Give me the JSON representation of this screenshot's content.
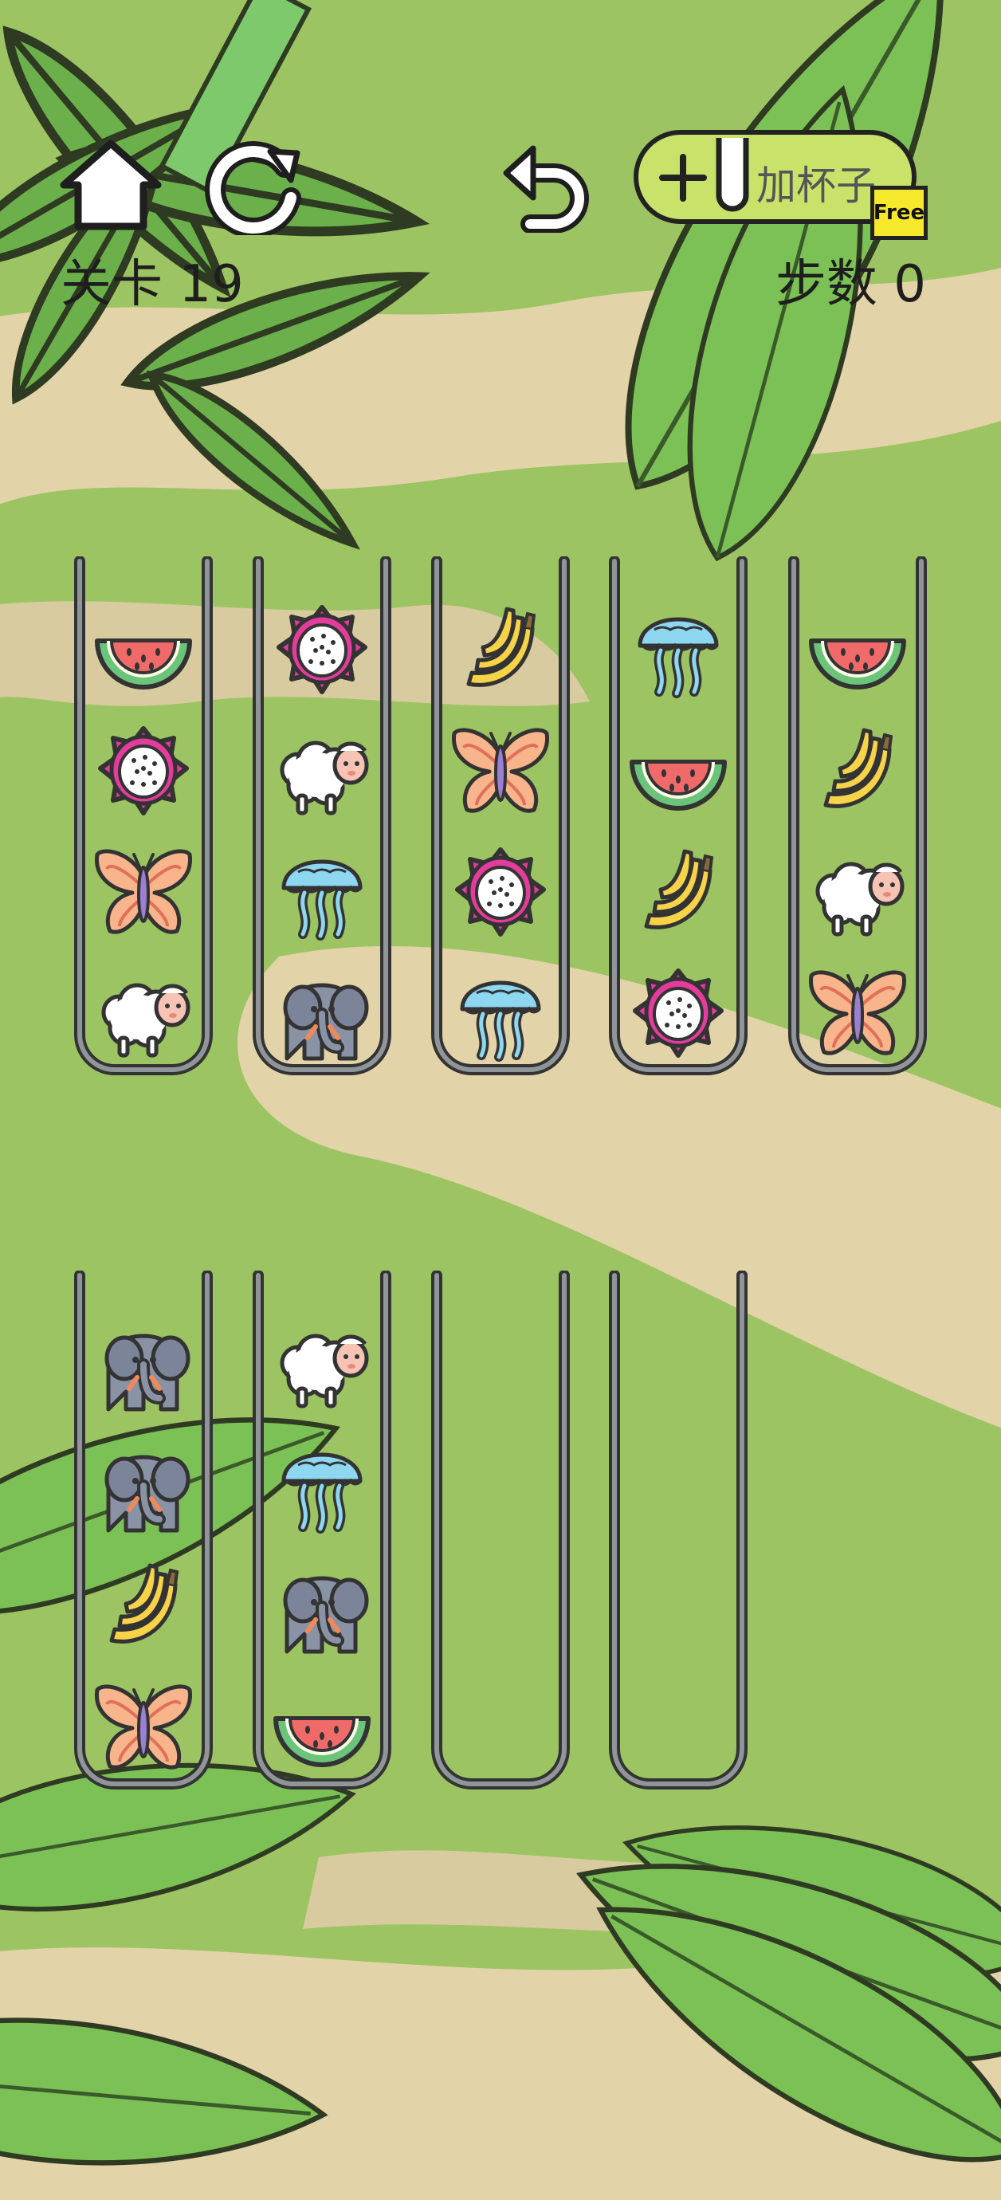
{
  "hud": {
    "level_text": "关卡 19",
    "moves_text": "步数 0",
    "add_cup_label": "加杯子",
    "free_badge": "Free"
  },
  "colors": {
    "background": "#9cc462",
    "path": "#e2d3a8",
    "leaf": "#6bb04a",
    "tube_outline": "#333333",
    "tube_inner": "#8f9598",
    "button_fill": "#c8e26a",
    "badge_fill": "#f6e92b"
  },
  "tubes": [
    {
      "items": [
        "watermelon-icon",
        "dragonfruit-icon",
        "butterfly-icon",
        "sheep-icon"
      ]
    },
    {
      "items": [
        "dragonfruit-icon",
        "sheep-icon",
        "jellyfish-icon",
        "elephant-icon"
      ]
    },
    {
      "items": [
        "banana-icon",
        "butterfly-icon",
        "dragonfruit-icon",
        "jellyfish-icon"
      ]
    },
    {
      "items": [
        "jellyfish-icon",
        "watermelon-icon",
        "banana-icon",
        "dragonfruit-icon"
      ]
    },
    {
      "items": [
        "watermelon-icon",
        "banana-icon",
        "sheep-icon",
        "butterfly-icon"
      ]
    },
    {
      "items": [
        "elephant-icon",
        "elephant-icon",
        "banana-icon",
        "butterfly-icon"
      ]
    },
    {
      "items": [
        "sheep-icon",
        "jellyfish-icon",
        "elephant-icon",
        "watermelon-icon"
      ]
    },
    {
      "items": []
    },
    {
      "items": []
    }
  ]
}
